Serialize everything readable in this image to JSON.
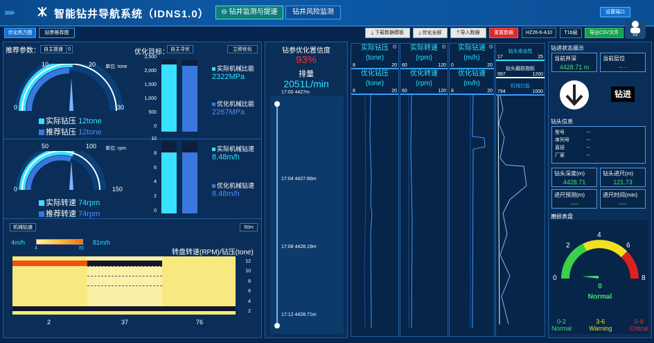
{
  "header": {
    "title": "智能钻井导航系统（IDNS1.0）",
    "tab_monitor": "钻井监测与提速",
    "tab_risk": "钻井风险监测",
    "settings": "设置端口",
    "user_label": "A\\/"
  },
  "toolbar": {
    "tab_heatmap": "优化热力图",
    "tab_recommend": "钻参推荐图",
    "download_template": "下载数据模板",
    "optimize_all": "优化全部",
    "import_data": "导入数据",
    "clear_data": "重置数据",
    "well_id": "HZ26-6-A10",
    "layer": "T1b层",
    "export_csv": "导出CSV文件"
  },
  "left": {
    "recommend_label": "推荐参数：",
    "auto_speed": "自主提速",
    "auto_speed_val": "0",
    "optimize_target": "优化目标：",
    "auto_optimize": "自主寻优",
    "instant_optimize": "立即优化",
    "wob_gauge": {
      "unit": "单位: tone",
      "t0": "0",
      "t10": "10",
      "t20": "20",
      "t30": "30",
      "actual_label": "实际钻压",
      "actual_val": "12tone",
      "rec_label": "推荐钻压",
      "rec_val": "12tone"
    },
    "rpm_gauge": {
      "unit": "单位: rpm",
      "t0": "0",
      "t50": "50",
      "t100": "100",
      "t150": "150",
      "actual_label": "实际转速",
      "actual_val": "74rpm",
      "rec_label": "推荐转速",
      "rec_val": "74rpm"
    },
    "mse_bars": {
      "ticks": [
        "2,500",
        "2,000",
        "1,500",
        "1,000",
        "500",
        "0"
      ],
      "actual_label": "实际机械比能",
      "actual_val": "2322MPa",
      "opt_label": "优化机械比能",
      "opt_val": "2267MPa",
      "actual_frac": 0.93,
      "opt_frac": 0.91
    },
    "rop_bars": {
      "ticks": [
        "10",
        "8",
        "6",
        "4",
        "2",
        "0"
      ],
      "actual_label": "实际机械钻速",
      "actual_val": "8.48m/h",
      "opt_label": "优化机械钻速",
      "opt_val": "8.48m/h",
      "actual_frac": 0.85,
      "opt_frac": 0.85
    },
    "heat": {
      "tab": "机械钻速",
      "depth_btn": "50m",
      "min": "4m/h",
      "max": "81m/h",
      "min_tick": "4",
      "max_tick": "81",
      "title": "转盘转速(RPM)/钻压(tone)",
      "y_ticks": [
        "12",
        "10",
        "8",
        "6",
        "4",
        "2"
      ],
      "x_ticks": [
        "2",
        "37",
        "76"
      ]
    }
  },
  "middle": {
    "title": "钻参优化置信度",
    "confidence": "93%",
    "flow_label": "排量",
    "flow_val": "2051L/min",
    "times": [
      "17:00 4427m",
      "17:04 4427.66m",
      "17:08 4428.19m",
      "17:12 4428.71m"
    ]
  },
  "tracks": [
    {
      "top": "实际钻压",
      "top_unit": "(tone)",
      "top_min": "8",
      "top_max": "20",
      "bot": "优化钻压",
      "bot_unit": "(tone)",
      "bot_min": "8",
      "bot_max": "20"
    },
    {
      "top": "实际转速",
      "top_unit": "(rpm)",
      "top_min": "60",
      "top_max": "120",
      "bot": "优化转速",
      "bot_unit": "(rpm)",
      "bot_min": "60",
      "bot_max": "120"
    },
    {
      "top": "实际钻速",
      "top_unit": "(m/h)",
      "top_min": "0",
      "top_max": "20",
      "bot": "优化钻速",
      "bot_unit": "(m/h)",
      "bot_min": "8",
      "bot_max": "20"
    }
  ],
  "track4": {
    "t1": "钻头攻击性",
    "t1_min": "17",
    "t1_max": "25",
    "t2": "钻头磨损指标",
    "t2_min": "997",
    "t2_max": "1200",
    "t3": "机械比能",
    "t3_min": "794",
    "t3_max": "1000"
  },
  "right": {
    "status_title": "钻进状态展示",
    "cur_depth_label": "当前井深",
    "cur_depth": "4428.71 m",
    "cur_layer_label": "当前层位",
    "cur_layer": "-- -",
    "state": "钻进",
    "bit_info": "钻头信息",
    "bit_rows": [
      {
        "k": "型号",
        "v": "--"
      },
      {
        "k": "序列号",
        "v": "--"
      },
      {
        "k": "直径",
        "v": "--"
      },
      {
        "k": "厂家",
        "v": "--"
      }
    ],
    "bit_depth_label": "钻头深度(m)",
    "bit_depth": "4428.71",
    "footage_label": "钻头进尺(m)",
    "footage": "121.73",
    "pred_label": "进尺预测(m)",
    "pred": "----",
    "time_label": "进尺时间(min)",
    "time": "----",
    "wear_title": "磨损表盘",
    "wear_ticks": [
      "0",
      "2",
      "4",
      "6",
      "8"
    ],
    "wear_val": "0",
    "wear_state": "Normal",
    "legend": [
      {
        "range": "0-2",
        "name": "Normal",
        "color": "#42e07a"
      },
      {
        "range": "3-6",
        "name": "Warning",
        "color": "#f0e020"
      },
      {
        "range": "6-8",
        "name": "Critical",
        "color": "#e03030"
      }
    ]
  }
}
